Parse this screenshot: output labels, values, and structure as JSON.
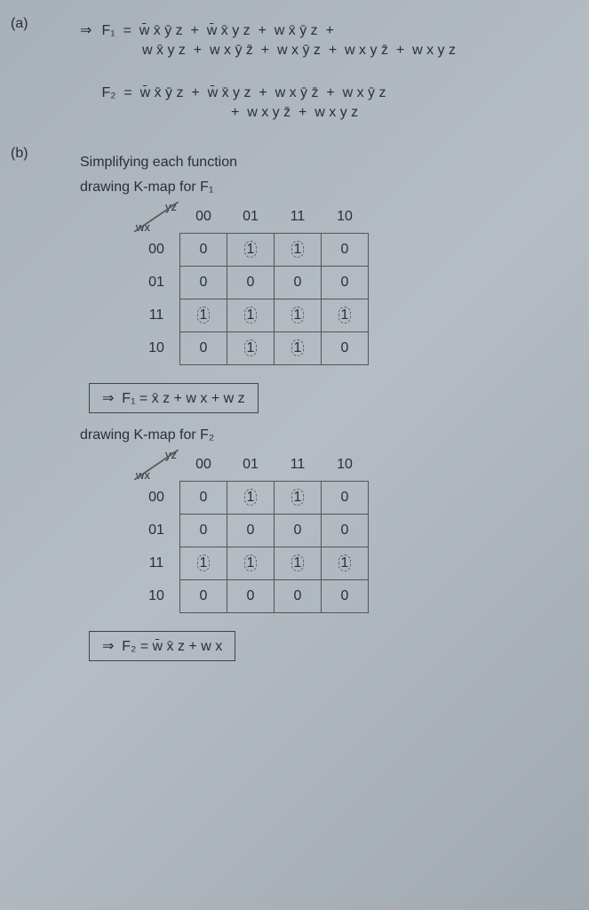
{
  "part_a": "(a)",
  "part_b": "(b)",
  "imp": "⇒",
  "F1_label": "F₁",
  "F2_label": "F₂",
  "eq": "=",
  "plus": "+",
  "F1_terms": [
    "w̄ x̄ ȳ z",
    "w̄ x̄ y z",
    "w x̄ ȳ z",
    "w x̄ y z",
    "w x ȳ z̄",
    "w x ȳ z",
    "w x y z̄",
    "w x y z"
  ],
  "F2_terms": [
    "w̄ x̄ ȳ z",
    "w̄ x̄ y z",
    "w x ȳ z̄",
    "w x ȳ z",
    "w x y z̄",
    "w x y z"
  ],
  "simplify_heading": "Simplifying each function",
  "draw_f1": "drawing K-map for F₁",
  "draw_f2": "drawing K-map for F₂",
  "axis_top": "yz",
  "axis_left": "wx",
  "cols": [
    "00",
    "01",
    "11",
    "10"
  ],
  "rows": [
    "00",
    "01",
    "11",
    "10"
  ],
  "kmap1": [
    [
      "0",
      "1",
      "1",
      "0"
    ],
    [
      "0",
      "0",
      "0",
      "0"
    ],
    [
      "1",
      "1",
      "1",
      "1"
    ],
    [
      "0",
      "1",
      "1",
      "0"
    ]
  ],
  "kmap2": [
    [
      "0",
      "1",
      "1",
      "0"
    ],
    [
      "0",
      "0",
      "0",
      "0"
    ],
    [
      "1",
      "1",
      "1",
      "1"
    ],
    [
      "0",
      "0",
      "0",
      "0"
    ]
  ],
  "F1_result": "F₁ = x̄ z + w x + w z",
  "F2_result": "F₂ = w̄ x̄ z + w x",
  "chart_data": [
    {
      "type": "table",
      "title": "K-map for F1",
      "row_axis": "wx",
      "col_axis": "yz",
      "rows": [
        "00",
        "01",
        "11",
        "10"
      ],
      "cols": [
        "00",
        "01",
        "11",
        "10"
      ],
      "values": [
        [
          0,
          1,
          1,
          0
        ],
        [
          0,
          0,
          0,
          0
        ],
        [
          1,
          1,
          1,
          1
        ],
        [
          0,
          1,
          1,
          0
        ]
      ]
    },
    {
      "type": "table",
      "title": "K-map for F2",
      "row_axis": "wx",
      "col_axis": "yz",
      "rows": [
        "00",
        "01",
        "11",
        "10"
      ],
      "cols": [
        "00",
        "01",
        "11",
        "10"
      ],
      "values": [
        [
          0,
          1,
          1,
          0
        ],
        [
          0,
          0,
          0,
          0
        ],
        [
          1,
          1,
          1,
          1
        ],
        [
          0,
          0,
          0,
          0
        ]
      ]
    }
  ]
}
